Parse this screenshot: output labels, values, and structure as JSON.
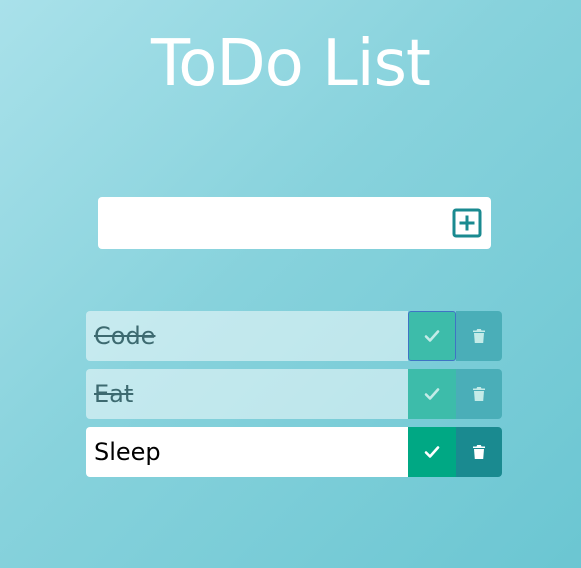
{
  "app": {
    "title": "ToDo List"
  },
  "add_form": {
    "input_value": "",
    "input_placeholder": "",
    "add_icon": "plus-square-icon"
  },
  "todos": [
    {
      "text": "Code",
      "completed": true,
      "check_icon": "check-icon",
      "delete_icon": "trash-icon"
    },
    {
      "text": "Eat",
      "completed": true,
      "check_icon": "check-icon",
      "delete_icon": "trash-icon"
    },
    {
      "text": "Sleep",
      "completed": false,
      "check_icon": "check-icon",
      "delete_icon": "trash-icon"
    }
  ],
  "colors": {
    "complete_button": "#00a884",
    "delete_button": "#1a8a90",
    "complete_button_done": "#3dbcaa",
    "delete_button_done": "#4aaeb8",
    "add_icon": "#1a8a90"
  }
}
